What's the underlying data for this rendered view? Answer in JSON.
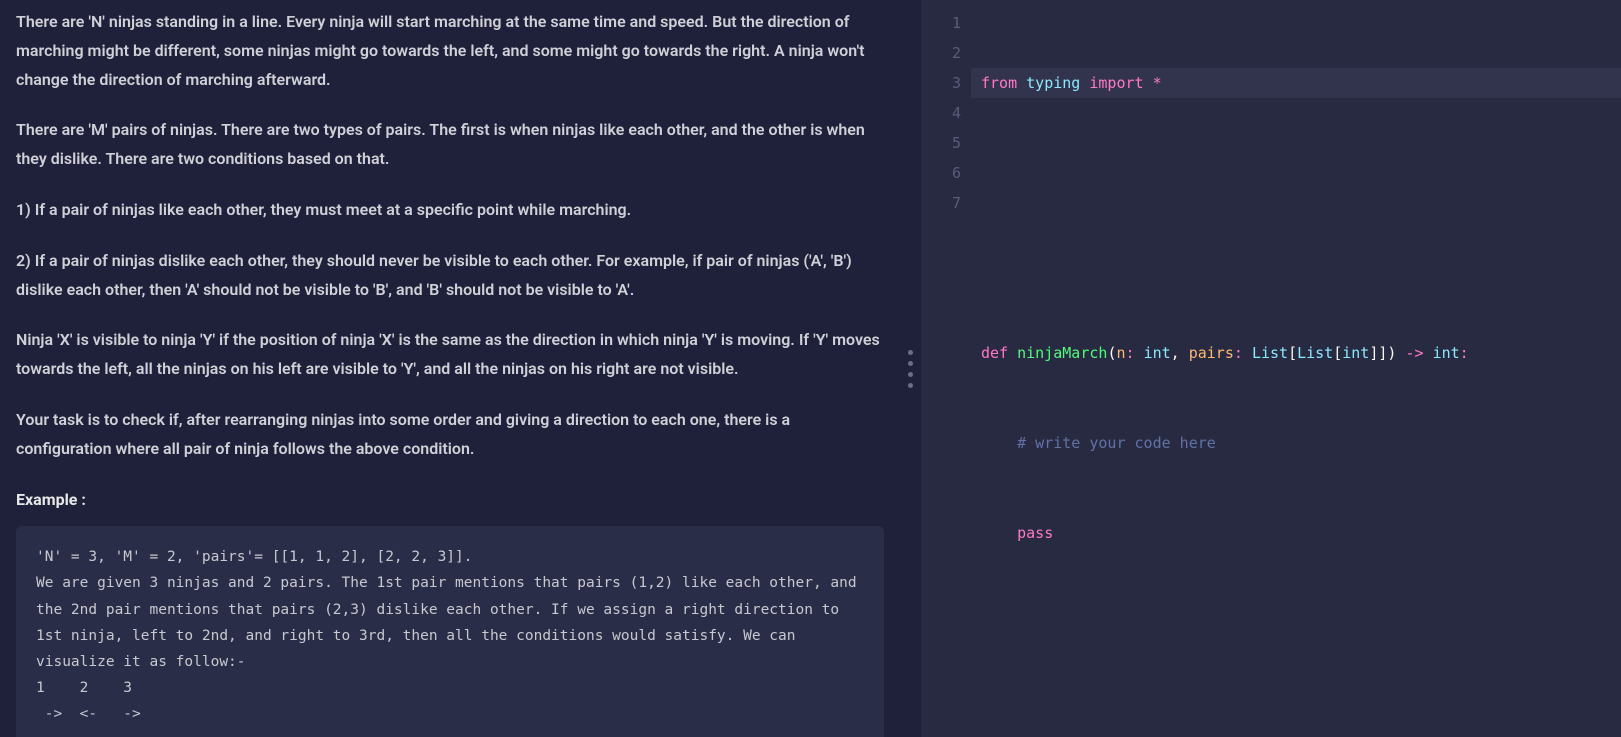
{
  "problem": {
    "paragraphs": [
      "There are 'N' ninjas standing in a line. Every ninja will start marching at the same time and speed. But the direction of marching might be different, some ninjas might go towards the left, and some might go towards the right. A ninja won't change the direction of marching afterward.",
      "There are 'M' pairs of ninjas. There are two types of pairs. The first is when ninjas like each other, and the other is when they dislike. There are two conditions based on that.",
      "1) If a pair of ninjas like each other, they must meet at a specific point while marching.",
      "2) If a pair of ninjas dislike each other, they should never be visible to each other. For example, if pair of ninjas ('A', 'B') dislike each other, then 'A' should not be visible to 'B', and 'B' should not be visible to 'A'.",
      "Ninja 'X' is visible to ninja 'Y' if the position of ninja 'X' is the same as the direction in which ninja 'Y' is moving. If 'Y' moves towards the left, all the ninjas on his left are visible to 'Y', and all the ninjas on his right are not visible.",
      "Your task is to check if, after rearranging ninjas into some order and giving a direction to each one, there is a configuration where all pair of ninja follows the above condition."
    ],
    "example_label": "Example :",
    "example_code": "'N' = 3, 'M' = 2, 'pairs'= [[1, 1, 2], [2, 2, 3]].\nWe are given 3 ninjas and 2 pairs. The 1st pair mentions that pairs (1,2) like each other, and the 2nd pair mentions that pairs (2,3) dislike each other. If we assign a right direction to 1st ninja, left to 2nd, and right to 3rd, then all the conditions would satisfy. We can visualize it as follow:-\n1    2    3\n ->  <-   ->"
  },
  "editor": {
    "line_numbers": [
      "1",
      "2",
      "3",
      "4",
      "5",
      "6",
      "7"
    ],
    "tokens": {
      "from": "from",
      "typing": "typing",
      "import": "import",
      "star": "*",
      "def": "def",
      "func_name": "ninjaMarch",
      "lparen": "(",
      "param_n": "n",
      "colon1": ": ",
      "type_int1": "int",
      "comma1": ", ",
      "param_pairs": "pairs",
      "colon2": ": ",
      "type_list1": "List",
      "lbracket1": "[",
      "type_list2": "List",
      "lbracket2": "[",
      "type_int2": "int",
      "rbracket1": "]",
      "rbracket2": "]",
      "rparen": ")",
      "arrow": " -> ",
      "type_int3": "int",
      "colon3": ":",
      "comment": "# write your code here",
      "pass": "pass",
      "indent": "    "
    }
  }
}
